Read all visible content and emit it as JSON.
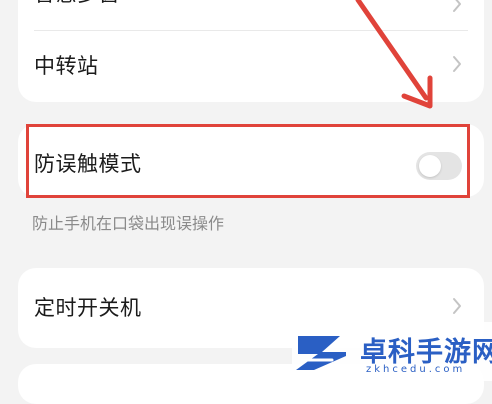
{
  "settings": {
    "top_item_partial": "智慧多窗",
    "transfer_station": "中转站",
    "anti_mistouch": "防误触模式",
    "anti_mistouch_enabled": false,
    "anti_mistouch_desc": "防止手机在口袋出现误操作",
    "scheduled_power": "定时开关机"
  },
  "watermark": {
    "title": "卓科手游网",
    "url": "zkhcedu.com"
  },
  "colors": {
    "highlight": "#e0433a",
    "watermark": "#2a5fc4"
  }
}
